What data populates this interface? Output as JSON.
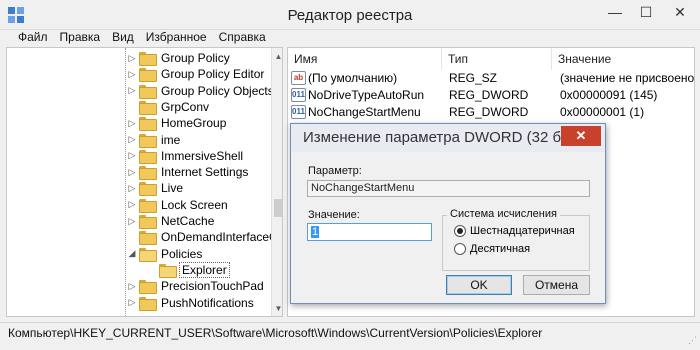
{
  "window": {
    "title": "Редактор реестра",
    "icon": "regedit-icon",
    "controls": {
      "minimize": "—",
      "maximize": "☐",
      "close": "✕"
    }
  },
  "menu": {
    "items": [
      "Файл",
      "Правка",
      "Вид",
      "Избранное",
      "Справка"
    ]
  },
  "tree": {
    "items": [
      {
        "label": "Group Policy",
        "expander": "▷"
      },
      {
        "label": "Group Policy Editor",
        "expander": "▷"
      },
      {
        "label": "Group Policy Objects",
        "expander": "▷"
      },
      {
        "label": "GrpConv",
        "expander": ""
      },
      {
        "label": "HomeGroup",
        "expander": "▷"
      },
      {
        "label": "ime",
        "expander": "▷"
      },
      {
        "label": "ImmersiveShell",
        "expander": "▷"
      },
      {
        "label": "Internet Settings",
        "expander": "▷"
      },
      {
        "label": "Live",
        "expander": "▷"
      },
      {
        "label": "Lock Screen",
        "expander": "▷"
      },
      {
        "label": "NetCache",
        "expander": "▷"
      },
      {
        "label": "OnDemandInterfaceCache",
        "expander": ""
      },
      {
        "label": "Policies",
        "expander": "◢"
      },
      {
        "label": "Explorer",
        "expander": ""
      },
      {
        "label": "PrecisionTouchPad",
        "expander": "▷"
      },
      {
        "label": "PushNotifications",
        "expander": "▷"
      }
    ],
    "selected": "Explorer"
  },
  "values": {
    "columns": {
      "name": "Имя",
      "type": "Тип",
      "value": "Значение"
    },
    "rows": [
      {
        "icon": "string-value-icon",
        "icon_text": "ab",
        "name": "(По умолчанию)",
        "type": "REG_SZ",
        "value": "(значение не присвоено)"
      },
      {
        "icon": "dword-value-icon",
        "icon_text": "011",
        "name": "NoDriveTypeAutoRun",
        "type": "REG_DWORD",
        "value": "0x00000091 (145)"
      },
      {
        "icon": "dword-value-icon",
        "icon_text": "011",
        "name": "NoChangeStartMenu",
        "type": "REG_DWORD",
        "value": "0x00000001 (1)"
      }
    ]
  },
  "status_bar": {
    "path": "Компьютер\\HKEY_CURRENT_USER\\Software\\Microsoft\\Windows\\CurrentVersion\\Policies\\Explorer"
  },
  "dialog": {
    "title": "Изменение параметра DWORD (32 бита)",
    "close_label": "✕",
    "param_label": "Параметр:",
    "param_value": "NoChangeStartMenu",
    "value_label": "Значение:",
    "value": "1",
    "base_group_label": "Система исчисления",
    "radio_hex": "Шестнадцатеричная",
    "radio_dec": "Десятичная",
    "selected_base": "hex",
    "ok_label": "OK",
    "cancel_label": "Отмена"
  }
}
